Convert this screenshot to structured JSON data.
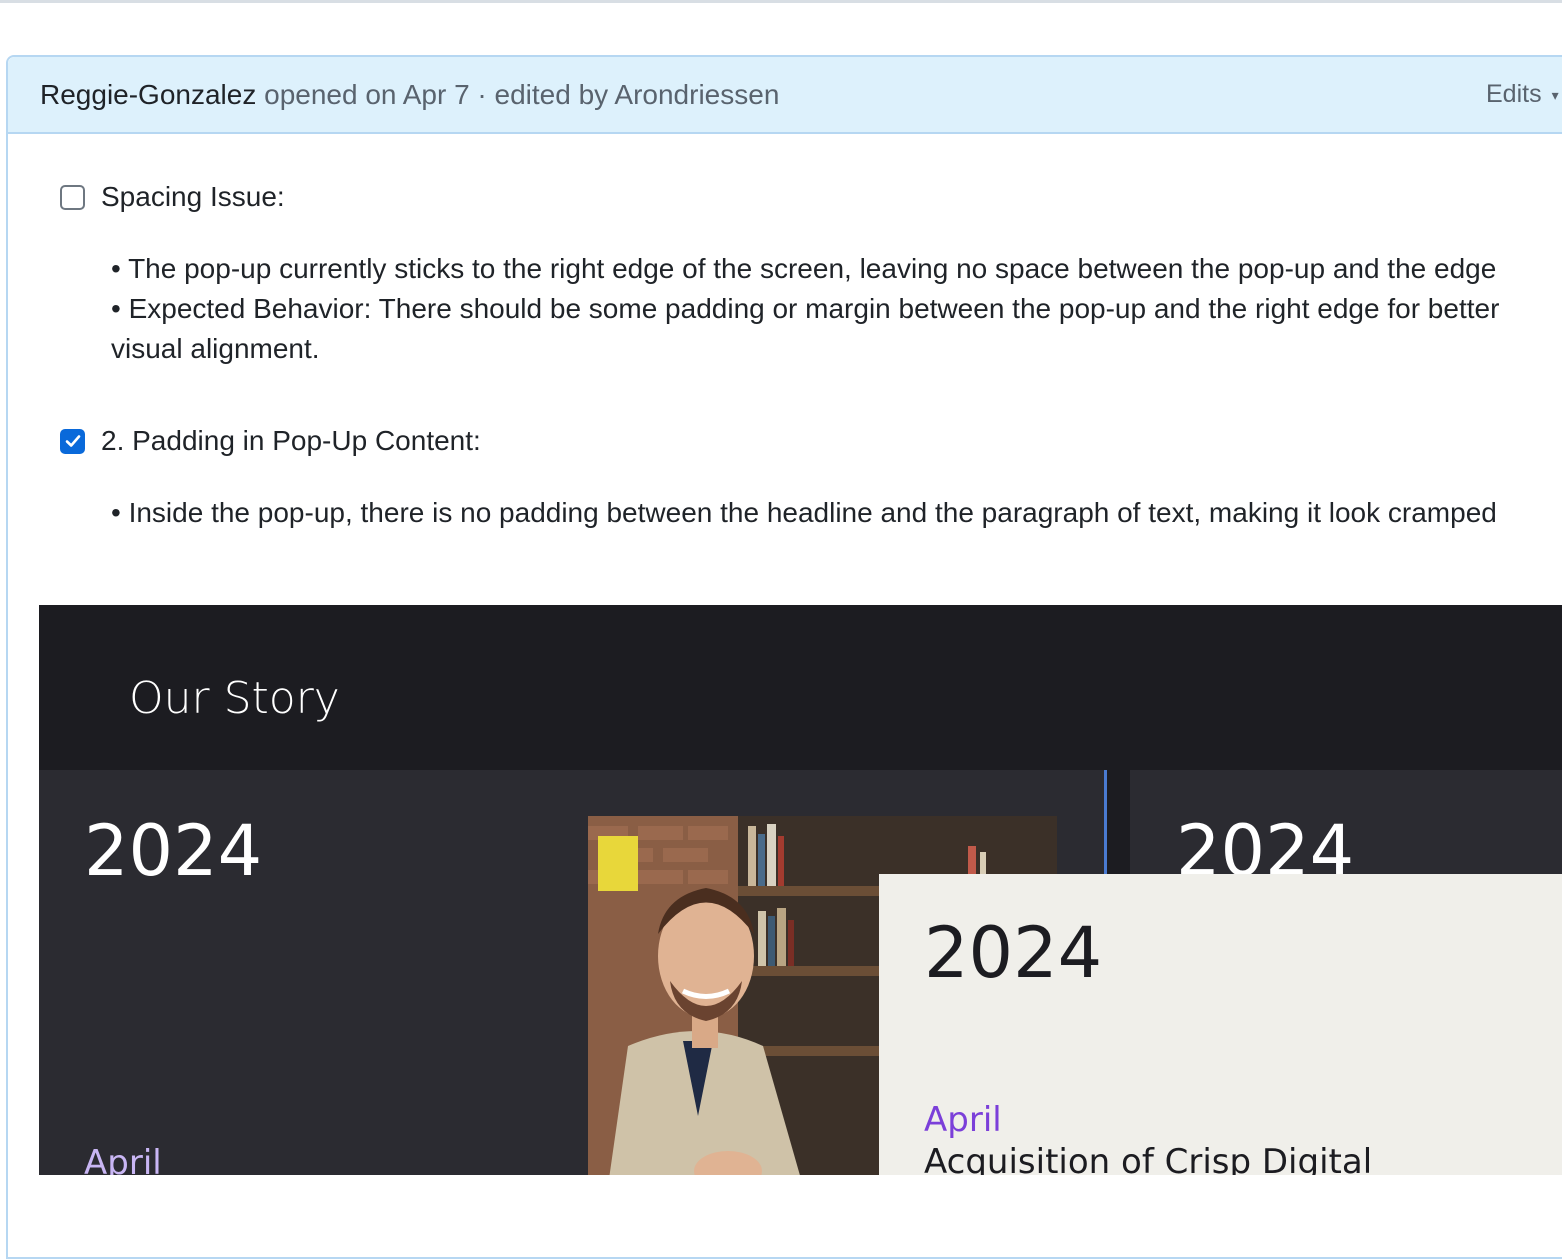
{
  "header": {
    "author": "Reggie-Gonzalez",
    "opened_text": "opened on Apr 7",
    "separator": "·",
    "edited_prefix": "edited by",
    "editor": "Arondriessen",
    "edits_label": "Edits"
  },
  "tasks": [
    {
      "checked": false,
      "label": "Spacing Issue:",
      "lines": [
        "• The pop-up currently sticks to the right edge of the screen, leaving no space between the pop-up and the edge",
        "• Expected Behavior: There should be some padding or margin between the pop-up and the right edge for better",
        "visual alignment."
      ]
    },
    {
      "checked": true,
      "label": "2. Padding in Pop-Up Content:",
      "lines": [
        "• Inside the pop-up, there is no padding between the headline and the paragraph of text, making it look cramped"
      ]
    }
  ],
  "screenshot": {
    "title": "Our Story",
    "left_year": "2024",
    "left_month": "April",
    "right_year": "2024",
    "popup": {
      "year": "2024",
      "month": "April",
      "headline": "Acquisition of Crisp Digital"
    }
  },
  "colors": {
    "header_bg": "#ddf1fc",
    "checkbox_checked": "#0969da",
    "dark_bg": "#1c1c21",
    "panel_bg": "#2b2b31",
    "popup_bg": "#f0efea",
    "accent_purple": "#7b3fd9"
  }
}
